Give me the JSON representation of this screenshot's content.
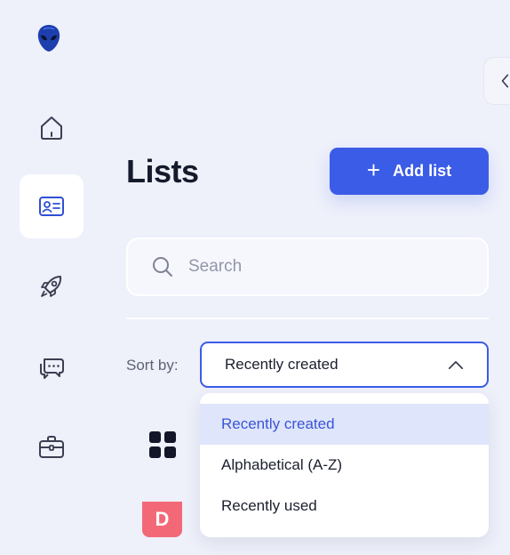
{
  "page": {
    "title": "Lists",
    "add_button_label": "Add list",
    "add_button_icon": "plus-icon"
  },
  "sidebar": {
    "logo": "alien-logo",
    "items": [
      {
        "name": "home",
        "icon": "home-icon",
        "active": false
      },
      {
        "name": "lists",
        "icon": "contact-card-icon",
        "active": true
      },
      {
        "name": "launch",
        "icon": "rocket-icon",
        "active": false
      },
      {
        "name": "chat",
        "icon": "chat-bubbles-icon",
        "active": false
      },
      {
        "name": "work",
        "icon": "briefcase-icon",
        "active": false
      }
    ]
  },
  "search": {
    "placeholder": "Search",
    "value": ""
  },
  "sort": {
    "label": "Sort by:",
    "selected": "Recently created",
    "options": [
      "Recently created",
      "Alphabetical (A-Z)",
      "Recently used"
    ]
  },
  "lists": [
    {
      "icon": "grid-icon"
    },
    {
      "avatar_letter": "D",
      "avatar_color": "#f26877"
    }
  ],
  "colors": {
    "accent": "#3b5ce6",
    "background": "#eef0fa",
    "selected_option_bg": "#dfe5fb"
  }
}
